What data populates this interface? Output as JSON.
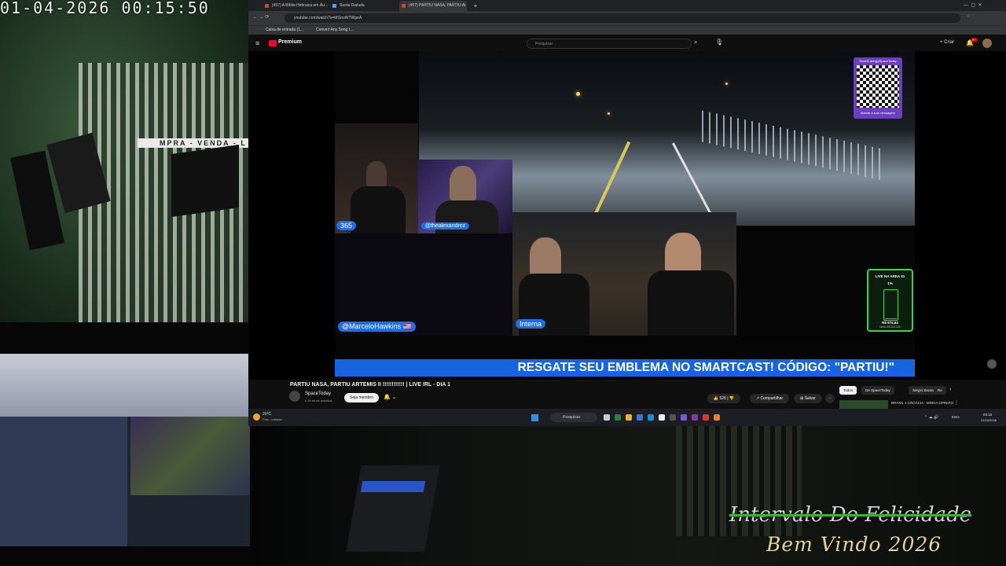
{
  "overlay": {
    "clock": "01-04-2026 00:15:50",
    "store_sign": "MPRA - VENDA - L",
    "footer_title": "Intervalo Do Felicidade",
    "footer_subtitle": "Bem Vindo 2026"
  },
  "browser": {
    "tabs": [
      {
        "label": "(457) A Bíblia Hebraica em Áu..."
      },
      {
        "label": "Sizzla Dialuda"
      },
      {
        "label": "(457) PARTIU NASA, PARTIU AI"
      }
    ],
    "url": "youtube.com/watch?v=MGnoWTWpeA",
    "bookmarks": [
      "Caixa de entrada (1...",
      "Convert Any Song t..."
    ]
  },
  "youtube": {
    "logo": "Premium",
    "search_placeholder": "Pesquisar",
    "create_label": "Criar",
    "notification_count": "9+",
    "video_title": "PARTIU NASA, PARTIU ARTEMIS II !!!!!!!!!!!! | LIVE IRL - DIA 1",
    "channel_name": "SpaceToday",
    "subscribers": "2,24 mi de inscritos",
    "join_label": "Seja membro",
    "likes": "526",
    "share_label": "Compartilhar",
    "save_label": "Salvar",
    "chips": [
      "Todos",
      "De SpaceToday",
      "Sérgio Sacani",
      "Re"
    ],
    "rec_title": "BRASIL x CROÁCIA - MINHA OPINIÃO"
  },
  "stream": {
    "qr_header": "SmartCast.gg/SpaceToday",
    "qr_footer": "Mande a sua mensagem",
    "cam_labels": [
      "365",
      "@thealexandrez",
      "@MarceloHawkins 🇺🇸",
      "Interna"
    ],
    "live_badge": {
      "title": "LIVE NA AREA 51",
      "percent": "1%",
      "value": 0.01,
      "amount": "R$ 875,84",
      "goal": "Meta R$ 100.000"
    },
    "banner": "RESGATE SEU EMBLEMA NO SMARTCAST! CÓDIGO: \"PARTIU!\""
  },
  "taskbar": {
    "weather_temp": "20°C",
    "weather_desc": "Parc. nublado",
    "search_placeholder": "Pesquisar",
    "lang": "ENG",
    "time": "00:15",
    "date": "01/04/2026"
  },
  "colors": {
    "youtube_red": "#ff0033",
    "banner_blue": "#1764e0",
    "live_green": "#3cd14a",
    "qr_purple": "#6b3fbf"
  }
}
